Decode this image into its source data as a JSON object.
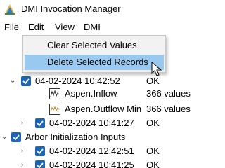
{
  "window": {
    "title": "DMI Invocation Manager"
  },
  "menubar": {
    "file": "File",
    "edit": "Edit",
    "view": "View",
    "dmi": "DMI"
  },
  "columns": {
    "name_header_partial": "DM",
    "status_header_partial": "us"
  },
  "edit_menu": {
    "items": [
      {
        "label": "Clear Selected Values",
        "highlighted": false
      },
      {
        "label": "Delete Selected Records",
        "highlighted": true
      }
    ]
  },
  "tree": {
    "rows": [
      {
        "label": "04-02-2024 10:42:52",
        "status": "OK",
        "checked": true,
        "expanded": true
      },
      {
        "label": "Aspen.Inflow",
        "status": "366 values",
        "icon": "graph-icon"
      },
      {
        "label": "Aspen.Outflow Min",
        "status": "366 values",
        "icon": "graph-icon"
      },
      {
        "label": "04-02-2024 10:41:27",
        "status": "OK",
        "checked": true,
        "expanded": false
      },
      {
        "label": "Arbor Initialization Inputs",
        "checked": true,
        "expanded": true
      },
      {
        "label": "04-02-2024 12:42:51",
        "status": "OK",
        "checked": true,
        "expanded": false
      },
      {
        "label": "04-02-2024 10:41:25",
        "status": "OK",
        "checked": true,
        "expanded": false
      }
    ]
  },
  "colors": {
    "check_blue": "#1e64b4",
    "menu_highlight": "#99c9ef",
    "menu_bg": "#f2f2f2"
  }
}
